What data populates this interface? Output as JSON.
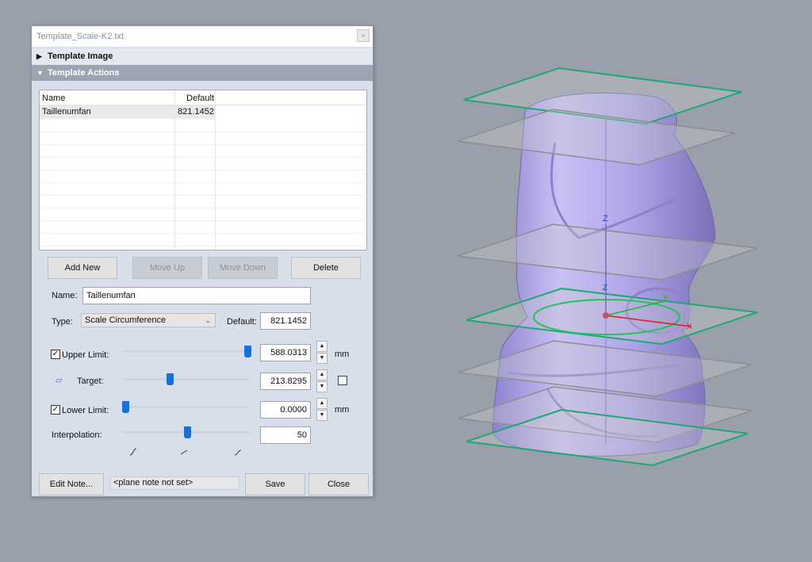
{
  "window": {
    "title": "Template_Scale-K2.txt",
    "close_icon": "×"
  },
  "sections": {
    "template_image": {
      "label": "Template Image",
      "icon": "▶"
    },
    "template_actions": {
      "label": "Template Actions",
      "icon": "▼"
    }
  },
  "table": {
    "columns": [
      "Name",
      "Default"
    ],
    "rows": [
      {
        "name": "Taillenumfan",
        "default": "821.1452"
      }
    ]
  },
  "buttons": {
    "add_new": "Add New",
    "move_up": "Move Up",
    "move_down": "Move Down",
    "delete": "Delete",
    "edit_note": "Edit Note...",
    "save": "Save",
    "close": "Close"
  },
  "form": {
    "name_label": "Name:",
    "name_value": "Taillenumfan",
    "type_label": "Type:",
    "type_value": "Scale Circumference",
    "default_label": "Default:",
    "default_value": "821.1452",
    "upper_limit_label": "Upper Limit:",
    "upper_limit_checked": true,
    "upper_limit_value": "588.0313",
    "upper_limit_unit": "mm",
    "target_label": "Target:",
    "target_value": "213.8295",
    "target_checked": false,
    "lower_limit_label": "Lower Limit:",
    "lower_limit_checked": true,
    "lower_limit_value": "0.0000",
    "lower_limit_unit": "mm",
    "interpolation_label": "Interpolation:",
    "interpolation_value": "50",
    "check_mark": "✓",
    "spin_up": "▲",
    "spin_down": "▼"
  },
  "note": {
    "text": "<plane note not set>"
  },
  "viewport": {
    "axis_label_z": "Z",
    "axis_label_y": "Y",
    "axis_label_x": "X",
    "colors": {
      "plane_active": "#1fa776",
      "plane_inactive": "#8e8e8e",
      "model": "#b3a9e8",
      "background": "#9aa0ab"
    }
  },
  "sliders": {
    "upper_limit_fraction": 1.0,
    "target_fraction": 0.36,
    "lower_limit_fraction": 0.0,
    "interpolation_fraction": 0.5
  }
}
